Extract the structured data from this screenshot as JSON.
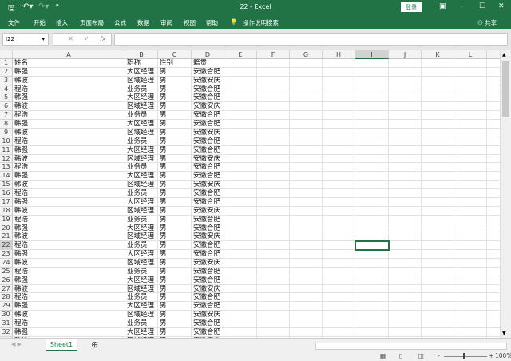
{
  "window": {
    "title": "22 - Excel",
    "login": "登录",
    "accent": "#217346"
  },
  "ribbon": {
    "tabs": [
      "文件",
      "开始",
      "插入",
      "页面布局",
      "公式",
      "数据",
      "审阅",
      "视图",
      "帮助"
    ],
    "search": "操作说明搜索",
    "share": "共享"
  },
  "formula_bar": {
    "name_box": "I22",
    "value": ""
  },
  "columns": [
    "A",
    "B",
    "C",
    "D",
    "E",
    "F",
    "G",
    "H",
    "I",
    "J",
    "K",
    "L"
  ],
  "selected_cell": {
    "col": "I",
    "row": 22
  },
  "rows": [
    [
      "姓名",
      "职称",
      "性别",
      "籍贯"
    ],
    [
      "韩强",
      "大区经理",
      "男",
      "安徽合肥"
    ],
    [
      "韩波",
      "区域经理",
      "男",
      "安徽安庆"
    ],
    [
      "程浩",
      "业务员",
      "男",
      "安徽合肥"
    ],
    [
      "韩强",
      "大区经理",
      "男",
      "安徽合肥"
    ],
    [
      "韩波",
      "区域经理",
      "男",
      "安徽安庆"
    ],
    [
      "程浩",
      "业务员",
      "男",
      "安徽合肥"
    ],
    [
      "韩强",
      "大区经理",
      "男",
      "安徽合肥"
    ],
    [
      "韩波",
      "区域经理",
      "男",
      "安徽安庆"
    ],
    [
      "程浩",
      "业务员",
      "男",
      "安徽合肥"
    ],
    [
      "韩强",
      "大区经理",
      "男",
      "安徽合肥"
    ],
    [
      "韩波",
      "区域经理",
      "男",
      "安徽安庆"
    ],
    [
      "程浩",
      "业务员",
      "男",
      "安徽合肥"
    ],
    [
      "韩强",
      "大区经理",
      "男",
      "安徽合肥"
    ],
    [
      "韩波",
      "区域经理",
      "男",
      "安徽安庆"
    ],
    [
      "程浩",
      "业务员",
      "男",
      "安徽合肥"
    ],
    [
      "韩强",
      "大区经理",
      "男",
      "安徽合肥"
    ],
    [
      "韩波",
      "区域经理",
      "男",
      "安徽安庆"
    ],
    [
      "程浩",
      "业务员",
      "男",
      "安徽合肥"
    ],
    [
      "韩强",
      "大区经理",
      "男",
      "安徽合肥"
    ],
    [
      "韩波",
      "区域经理",
      "男",
      "安徽安庆"
    ],
    [
      "程浩",
      "业务员",
      "男",
      "安徽合肥"
    ],
    [
      "韩强",
      "大区经理",
      "男",
      "安徽合肥"
    ],
    [
      "韩波",
      "区域经理",
      "男",
      "安徽安庆"
    ],
    [
      "程浩",
      "业务员",
      "男",
      "安徽合肥"
    ],
    [
      "韩强",
      "大区经理",
      "男",
      "安徽合肥"
    ],
    [
      "韩波",
      "区域经理",
      "男",
      "安徽安庆"
    ],
    [
      "程浩",
      "业务员",
      "男",
      "安徽合肥"
    ],
    [
      "韩强",
      "大区经理",
      "男",
      "安徽合肥"
    ],
    [
      "韩波",
      "区域经理",
      "男",
      "安徽安庆"
    ],
    [
      "程浩",
      "业务员",
      "男",
      "安徽合肥"
    ],
    [
      "韩强",
      "大区经理",
      "男",
      "安徽合肥"
    ],
    [
      "韩波",
      "区域经理",
      "男",
      "安徽安庆"
    ]
  ],
  "sheet_tabs": [
    "Sheet1"
  ],
  "status": {
    "zoom": "100%"
  }
}
